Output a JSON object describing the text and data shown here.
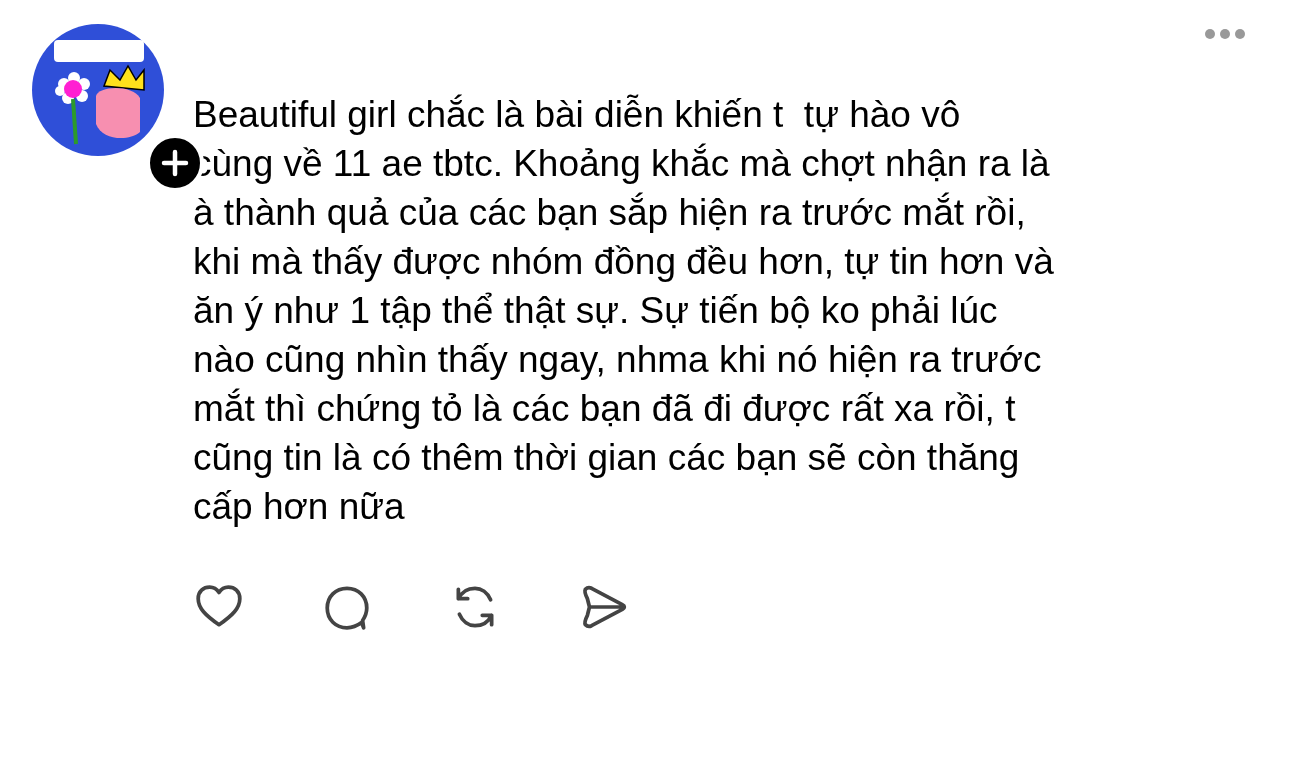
{
  "post": {
    "text": "Beautiful girl chắc là bài diễn khiến t  tự hào vô\ncùng về 11 ae tbtc. Khoảng khắc mà chợt nhận ra là\nà thành quả của các bạn sắp hiện ra trước mắt rồi,\nkhi mà thấy được nhóm đồng đều hơn, tự tin hơn và\năn ý như 1 tập thể thật sự. Sự tiến bộ ko phải lúc\nnào cũng nhìn thấy ngay, nhma khi nó hiện ra trước\nmắt thì chứng tỏ là các bạn đã đi được rất xa rồi, t\ncũng tin là có thêm thời gian các bạn sẽ còn thăng\ncấp hơn nữa"
  },
  "actions": [
    {
      "kind": "like"
    },
    {
      "kind": "comment"
    },
    {
      "kind": "repost"
    },
    {
      "kind": "share"
    }
  ]
}
